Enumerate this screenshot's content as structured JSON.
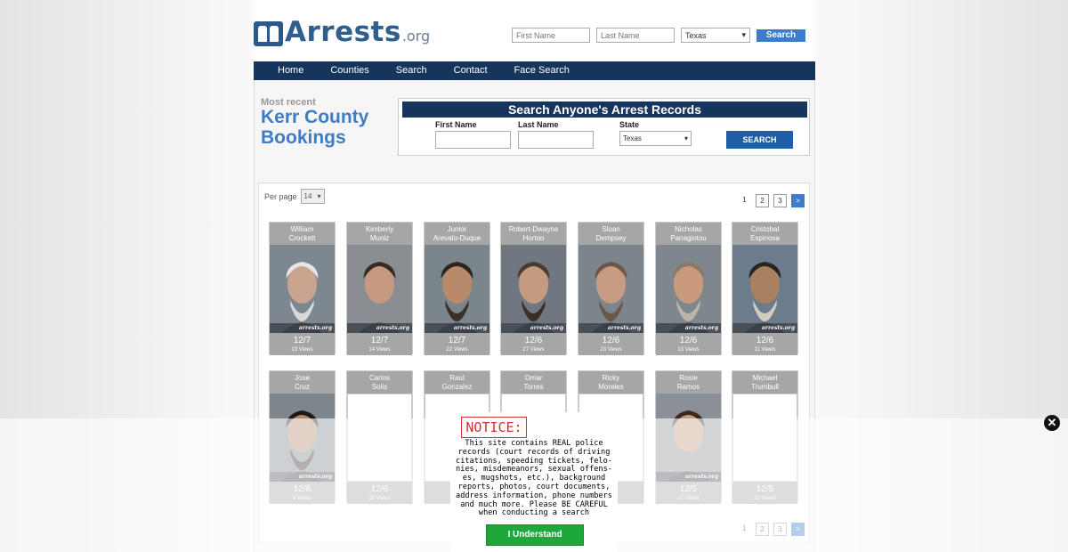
{
  "header": {
    "logo_text": "Arrests",
    "logo_tld": ".org",
    "first_name_placeholder": "First Name",
    "last_name_placeholder": "Last Name",
    "state_value": "Texas",
    "search_label": "Search"
  },
  "nav": {
    "items": [
      "Home",
      "Counties",
      "Search",
      "Contact",
      "Face Search"
    ]
  },
  "page": {
    "most_recent": "Most recent",
    "title": "Kerr County Bookings"
  },
  "search_box": {
    "title": "Search Anyone's Arrest Records",
    "first_name_label": "First Name",
    "last_name_label": "Last Name",
    "state_label": "State",
    "state_value": "Texas",
    "button_label": "SEARCH"
  },
  "listing": {
    "per_page_label": "Per page",
    "per_page_value": "14",
    "pages": [
      "1",
      "2",
      "3",
      ">"
    ]
  },
  "watermark": "arrests.org",
  "cards": [
    {
      "first": "William",
      "last": "Crockett",
      "date": "12/7",
      "views": "13 Views",
      "photo": true
    },
    {
      "first": "Kimberly",
      "last": "Muniz",
      "date": "12/7",
      "views": "14 Views",
      "photo": true
    },
    {
      "first": "Junior",
      "last": "Arevalo-Duque",
      "date": "12/7",
      "views": "22 Views",
      "photo": true
    },
    {
      "first": "Robert-Dwayne",
      "last": "Horton",
      "date": "12/6",
      "views": "27 Views",
      "photo": true
    },
    {
      "first": "Sloan",
      "last": "Dempsey",
      "date": "12/6",
      "views": "23 Views",
      "photo": true
    },
    {
      "first": "Nicholas",
      "last": "Panagiotou",
      "date": "12/6",
      "views": "13 Views",
      "photo": true
    },
    {
      "first": "Cristobal",
      "last": "Espinosa",
      "date": "12/6",
      "views": "11 Views",
      "photo": true
    },
    {
      "first": "Jose",
      "last": "Cruz",
      "date": "12/6",
      "views": "8 Views",
      "photo": true
    },
    {
      "first": "Carlos",
      "last": "Solis",
      "date": "12/6",
      "views": "18 Views",
      "photo": false
    },
    {
      "first": "Raul",
      "last": "Gonzalez",
      "date": "",
      "views": "",
      "photo": false
    },
    {
      "first": "Omar",
      "last": "Torres",
      "date": "",
      "views": "",
      "photo": false
    },
    {
      "first": "Ricky",
      "last": "Morales",
      "date": "",
      "views": "",
      "photo": false
    },
    {
      "first": "Rosie",
      "last": "Ramos",
      "date": "12/5",
      "views": "17 Views",
      "photo": true
    },
    {
      "first": "Michael",
      "last": "Trumbull",
      "date": "12/5",
      "views": "12 Views",
      "photo": false
    }
  ],
  "notice": {
    "title": "NOTICE:",
    "lines": [
      "This site contains REAL police",
      "records (court records of driving",
      "citations, speeding tickets, felo-",
      "nies, misdemeanors, sexual offens-",
      "es, mugshots, etc.), background",
      "reports, photos, court documents,",
      "address information, phone numbers",
      "and much more. Please BE CAREFUL",
      "when conducting a search"
    ],
    "button_label": "I Understand"
  },
  "overlay": {
    "close_glyph": "✕"
  },
  "colors": {
    "navy": "#16355c",
    "accent_blue": "#3d7cc9",
    "notice_red": "#cc3333",
    "notice_green": "#1ea83c"
  }
}
